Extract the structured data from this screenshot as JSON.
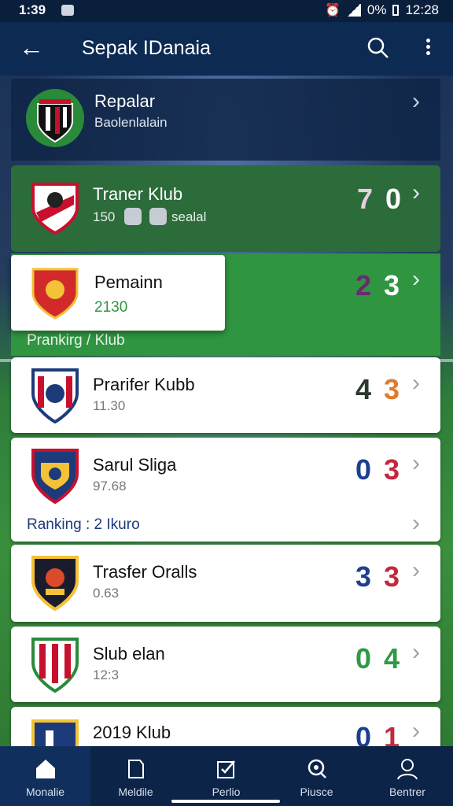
{
  "status_bar": {
    "time": "1:39",
    "battery": "0%",
    "clock_right": "12:28"
  },
  "app_bar": {
    "title": "Sepak IDanaia"
  },
  "header_card": {
    "title": "Repalar",
    "subtitle": "Baolenlalain"
  },
  "matches": [
    {
      "name": "Traner Klub",
      "sub": "150",
      "sub_extra": "sealal",
      "score_a": "7",
      "score_b": "0",
      "color_a": "#e8cfe0",
      "color_b": "#ffffff"
    },
    {
      "name": "Pemainn",
      "sub": "2130",
      "score_a": "2",
      "score_b": "3",
      "color_a": "#6b2a6e",
      "color_b": "#ffffff"
    },
    {
      "name": "Prarifer Kubb",
      "sub": "11.30",
      "score_a": "4",
      "score_b": "3",
      "color_a": "#2b3a2b",
      "color_b": "#e07b2b"
    },
    {
      "name": "Sarul Sliga",
      "sub": "97.68",
      "score_a": "0",
      "score_b": "3",
      "color_a": "#1c3f8e",
      "color_b": "#c4283b"
    },
    {
      "name": "Trasfer Oralls",
      "sub": "0.63",
      "score_a": "3",
      "score_b": "3",
      "color_a": "#1c3f8e",
      "color_b": "#c4283b"
    },
    {
      "name": "Slub elan",
      "sub": "12:3",
      "score_a": "0",
      "score_b": "4",
      "color_a": "#2f9a45",
      "color_b": "#2f9a45"
    },
    {
      "name": "2019 Klub",
      "sub": "",
      "score_a": "0",
      "score_b": "1",
      "color_a": "#1c3f8e",
      "color_b": "#c4283b"
    }
  ],
  "ranking_banner": "Prankirg / Klub",
  "ranking_row": "Ranking : 2 Ikuro",
  "nav": [
    {
      "label": "Monalie",
      "icon": "home-icon"
    },
    {
      "label": "Meldile",
      "icon": "tag-icon"
    },
    {
      "label": "Perlio",
      "icon": "checklist-icon"
    },
    {
      "label": "Piusce",
      "icon": "search-icon"
    },
    {
      "label": "Bentrer",
      "icon": "profile-icon"
    }
  ],
  "colors": {
    "accent": "#0d2a52",
    "green": "#2f9540"
  }
}
